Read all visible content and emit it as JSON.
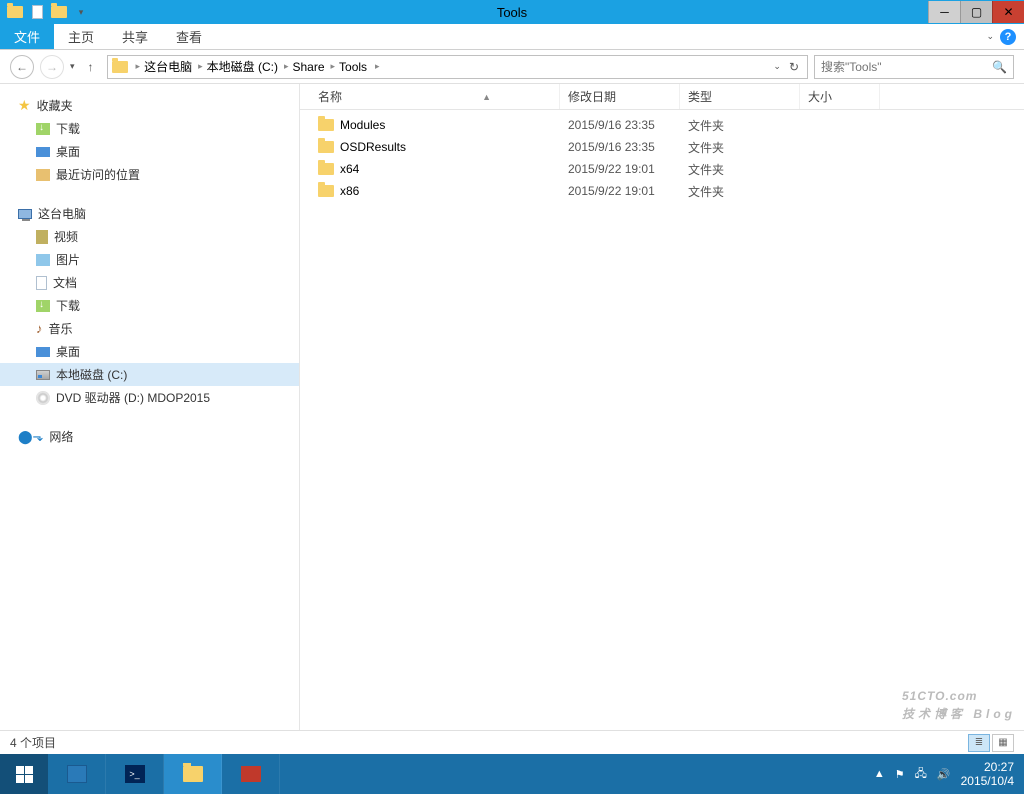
{
  "window": {
    "title": "Tools"
  },
  "ribbon": {
    "file": "文件",
    "tabs": [
      "主页",
      "共享",
      "查看"
    ]
  },
  "breadcrumbs": [
    "这台电脑",
    "本地磁盘 (C:)",
    "Share",
    "Tools"
  ],
  "search": {
    "placeholder": "搜索\"Tools\""
  },
  "nav": {
    "favorites": {
      "label": "收藏夹",
      "items": [
        "下载",
        "桌面",
        "最近访问的位置"
      ]
    },
    "this_pc": {
      "label": "这台电脑",
      "items": [
        "视频",
        "图片",
        "文档",
        "下载",
        "音乐",
        "桌面",
        "本地磁盘 (C:)",
        "DVD 驱动器 (D:) MDOP2015"
      ]
    },
    "network": {
      "label": "网络"
    }
  },
  "columns": {
    "name": "名称",
    "date": "修改日期",
    "type": "类型",
    "size": "大小"
  },
  "rows": [
    {
      "name": "Modules",
      "date": "2015/9/16 23:35",
      "type": "文件夹"
    },
    {
      "name": "OSDResults",
      "date": "2015/9/16 23:35",
      "type": "文件夹"
    },
    {
      "name": "x64",
      "date": "2015/9/22 19:01",
      "type": "文件夹"
    },
    {
      "name": "x86",
      "date": "2015/9/22 19:01",
      "type": "文件夹"
    }
  ],
  "status": {
    "count": "4 个项目"
  },
  "tray": {
    "time": "20:27",
    "date": "2015/10/4"
  },
  "watermark": {
    "line1": "51CTO.com",
    "line2": "技术博客 Blog"
  }
}
